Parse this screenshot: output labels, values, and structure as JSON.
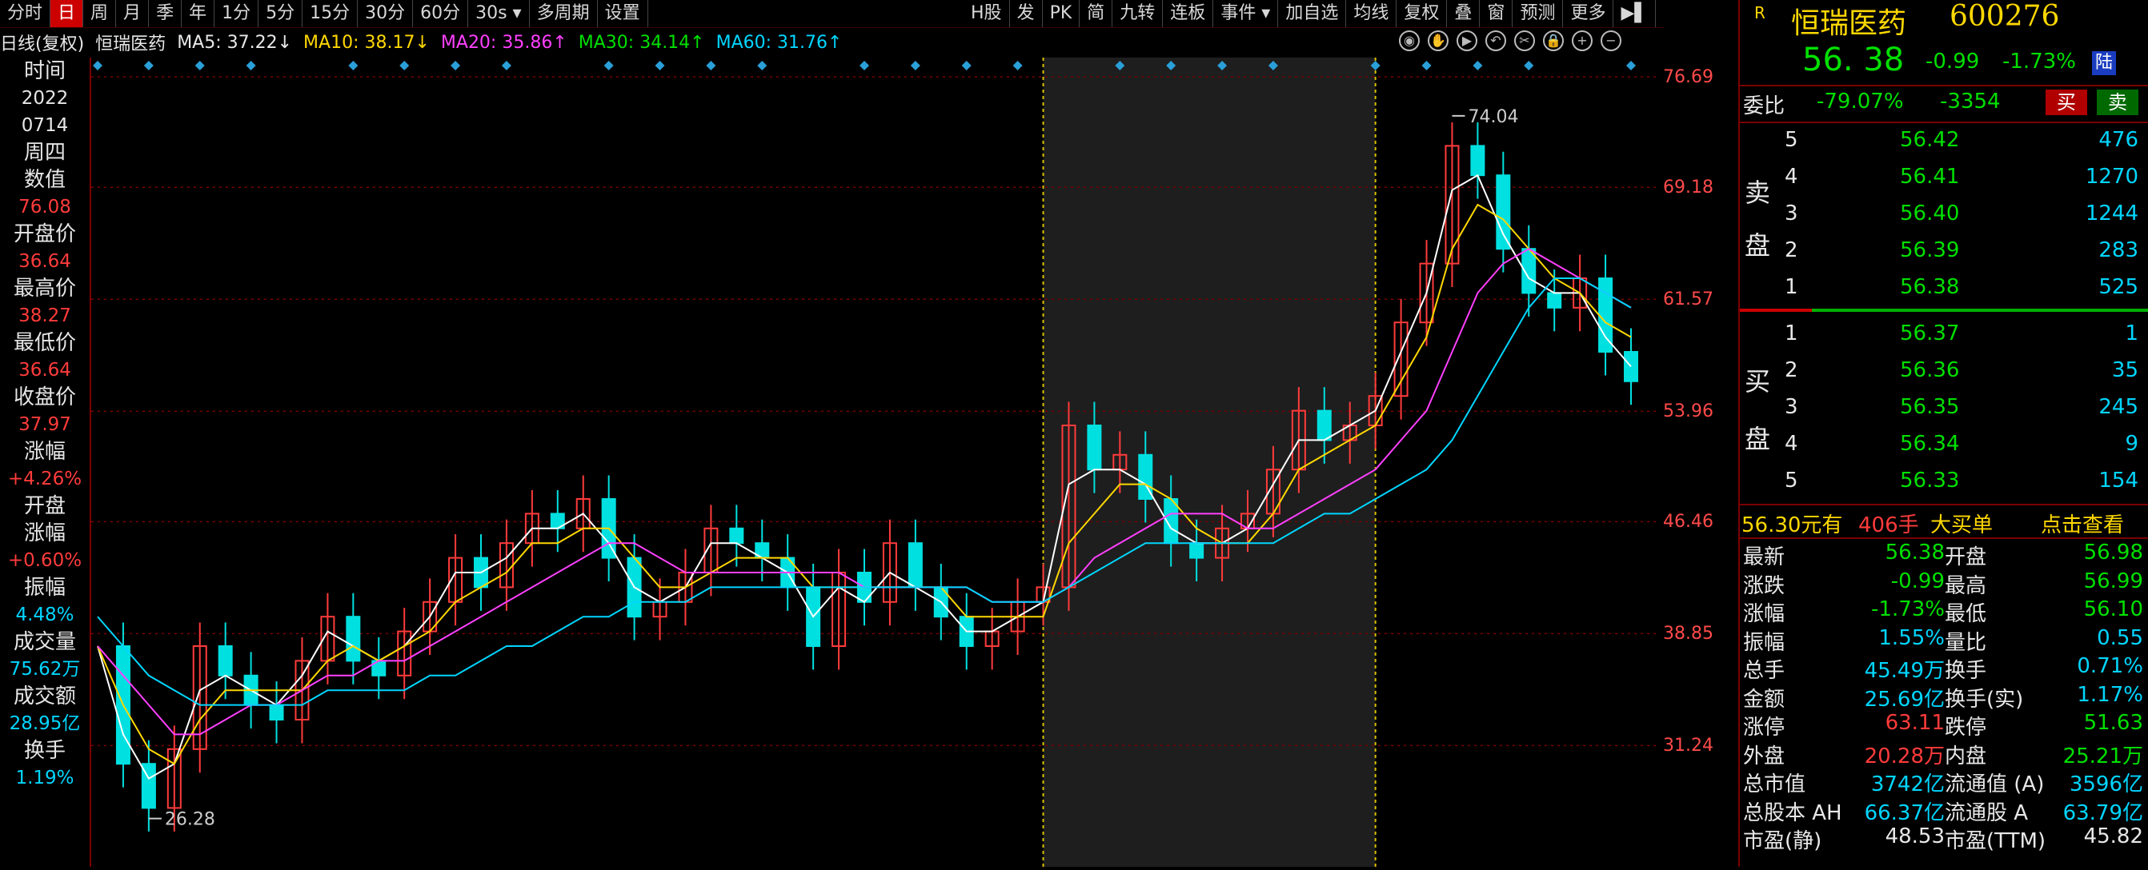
{
  "toolbar": {
    "left": [
      "分时",
      "日",
      "周",
      "月",
      "季",
      "年",
      "1分",
      "5分",
      "15分",
      "30分",
      "60分",
      "30s ▾",
      "多周期",
      "设置"
    ],
    "active_index": 1,
    "right": [
      "H股",
      "发",
      "PK",
      "简",
      "九转",
      "连板",
      "事件 ▾",
      "加自选",
      "均线",
      "复权",
      "叠",
      "窗",
      "预测",
      "更多",
      "▶▌"
    ]
  },
  "ma_row": {
    "prefix": "日线(复权)",
    "stock": "恒瑞医药",
    "ma5": "MA5: 37.22↓",
    "ma10": "MA10: 38.17↓",
    "ma20": "MA20: 35.86↑",
    "ma30": "MA30: 34.14↑",
    "ma60": "MA60: 31.76↑"
  },
  "chart_tools": [
    "eye",
    "hand",
    "play",
    "undo",
    "cut",
    "lock",
    "plus",
    "minus"
  ],
  "left_panel": [
    {
      "label": "时间",
      "value": "2022",
      "color": "#e6e6e6"
    },
    {
      "label": "",
      "value": "0714",
      "color": "#e6e6e6"
    },
    {
      "label": "周四",
      "value": "",
      "color": "#e6e6e6"
    },
    {
      "label": "数值",
      "value": "76.08",
      "color": "#ff3b3b"
    },
    {
      "label": "开盘价",
      "value": "36.64",
      "color": "#ff3b3b"
    },
    {
      "label": "最高价",
      "value": "38.27",
      "color": "#ff3b3b"
    },
    {
      "label": "最低价",
      "value": "36.64",
      "color": "#ff3b3b"
    },
    {
      "label": "收盘价",
      "value": "37.97",
      "color": "#ff3b3b"
    },
    {
      "label": "涨幅",
      "value": "+4.26%",
      "color": "#ff3b3b"
    },
    {
      "label": "开盘",
      "value": "",
      "color": "#e6e6e6"
    },
    {
      "label": "涨幅",
      "value": "+0.60%",
      "color": "#ff3b3b"
    },
    {
      "label": "振幅",
      "value": "4.48%",
      "color": "#00d6ff"
    },
    {
      "label": "成交量",
      "value": "75.62万",
      "color": "#00d6ff"
    },
    {
      "label": "成交额",
      "value": "28.95亿",
      "color": "#00d6ff"
    },
    {
      "label": "换手",
      "value": "1.19%",
      "color": "#00d6ff"
    }
  ],
  "chart_data": {
    "type": "line",
    "y_axis": [
      76.69,
      69.18,
      61.57,
      53.96,
      46.46,
      38.85,
      31.24
    ],
    "ylim": [
      23.0,
      78.0
    ],
    "max_label": "74.04",
    "min_label": "26.28",
    "x": [
      0,
      4,
      8,
      12,
      16,
      20,
      24,
      28,
      32,
      36,
      40,
      44,
      48,
      52,
      56,
      60,
      64,
      68,
      72,
      76,
      80,
      84,
      88,
      92,
      96,
      100,
      104,
      108,
      112,
      116,
      120,
      124,
      128,
      132,
      136,
      140,
      144,
      148,
      152,
      156,
      160,
      164,
      168,
      172,
      176,
      180,
      184,
      188,
      192,
      196,
      200,
      204,
      208,
      212,
      216,
      220,
      224,
      228,
      232,
      236,
      240
    ],
    "close": [
      38,
      30,
      27,
      31,
      38,
      36,
      34,
      33,
      37,
      40,
      37,
      36,
      39,
      41,
      44,
      42,
      45,
      47,
      46,
      48,
      44,
      40,
      41,
      43,
      46,
      45,
      44,
      42,
      38,
      43,
      41,
      45,
      42,
      40,
      38,
      39,
      41,
      42,
      53,
      50,
      51,
      48,
      45,
      44,
      46,
      47,
      50,
      54,
      52,
      53,
      55,
      60,
      64,
      72,
      70,
      65,
      62,
      61,
      63,
      58,
      56
    ],
    "series": [
      {
        "name": "MA5",
        "color": "#ffffff",
        "values": [
          38,
          32,
          29,
          30,
          35,
          36,
          35,
          34,
          36,
          39,
          38,
          37,
          38,
          40,
          43,
          43,
          44,
          46,
          46,
          47,
          45,
          42,
          41,
          42,
          45,
          45,
          44,
          43,
          40,
          42,
          41,
          43,
          42,
          41,
          39,
          39,
          40,
          41,
          49,
          50,
          50,
          49,
          46,
          45,
          45,
          46,
          49,
          52,
          52,
          53,
          54,
          58,
          62,
          69,
          70,
          66,
          63,
          62,
          62,
          59,
          57
        ]
      },
      {
        "name": "MA10",
        "color": "#ffd800",
        "values": [
          38,
          34,
          31,
          30,
          33,
          35,
          35,
          35,
          35,
          37,
          38,
          37,
          38,
          39,
          41,
          42,
          43,
          45,
          45,
          46,
          46,
          44,
          42,
          42,
          43,
          44,
          44,
          44,
          42,
          42,
          42,
          42,
          42,
          42,
          40,
          40,
          40,
          40,
          45,
          47,
          49,
          49,
          48,
          46,
          45,
          45,
          47,
          50,
          51,
          52,
          53,
          56,
          59,
          65,
          68,
          67,
          65,
          63,
          62,
          60,
          59
        ]
      },
      {
        "name": "MA20",
        "color": "#ff40ff",
        "values": [
          38,
          36,
          34,
          32,
          32,
          33,
          34,
          34,
          35,
          36,
          36,
          37,
          37,
          38,
          39,
          40,
          41,
          42,
          43,
          44,
          45,
          45,
          44,
          43,
          43,
          43,
          43,
          43,
          43,
          43,
          42,
          42,
          42,
          42,
          42,
          41,
          41,
          41,
          42,
          44,
          45,
          46,
          47,
          47,
          47,
          46,
          46,
          47,
          48,
          49,
          50,
          52,
          54,
          58,
          62,
          64,
          65,
          64,
          63,
          62,
          61
        ]
      },
      {
        "name": "MA60",
        "color": "#00d6ff",
        "values": [
          40,
          38,
          36,
          35,
          34,
          34,
          34,
          34,
          34,
          35,
          35,
          35,
          35,
          36,
          36,
          37,
          38,
          38,
          39,
          40,
          40,
          41,
          41,
          41,
          42,
          42,
          42,
          42,
          42,
          42,
          42,
          42,
          42,
          42,
          42,
          41,
          41,
          41,
          42,
          43,
          44,
          45,
          45,
          45,
          45,
          45,
          45,
          46,
          47,
          47,
          48,
          49,
          50,
          52,
          55,
          58,
          61,
          63,
          63,
          62,
          61
        ]
      }
    ],
    "highlight_range": [
      148,
      200
    ],
    "grid": true
  },
  "right_panel": {
    "badge": "R",
    "name": "恒瑞医药",
    "code": "600276",
    "price": "56. 38",
    "change": "-0.99",
    "change_pct": "-1.73%",
    "market_tag": "陆",
    "weibi_label": "委比",
    "weibi_pct": "-79.07%",
    "weicha": "-3354",
    "buy_btn": "买",
    "sell_btn": "卖",
    "sell_side_label": [
      "卖",
      "盘"
    ],
    "buy_side_label": [
      "买",
      "盘"
    ],
    "asks": [
      {
        "lvl": "5",
        "price": "56.42",
        "vol": "476"
      },
      {
        "lvl": "4",
        "price": "56.41",
        "vol": "1270"
      },
      {
        "lvl": "3",
        "price": "56.40",
        "vol": "1244"
      },
      {
        "lvl": "2",
        "price": "56.39",
        "vol": "283"
      },
      {
        "lvl": "1",
        "price": "56.38",
        "vol": "525"
      }
    ],
    "bids": [
      {
        "lvl": "1",
        "price": "56.37",
        "vol": "1"
      },
      {
        "lvl": "2",
        "price": "56.36",
        "vol": "35"
      },
      {
        "lvl": "3",
        "price": "56.35",
        "vol": "245"
      },
      {
        "lvl": "4",
        "price": "56.34",
        "vol": "9"
      },
      {
        "lvl": "5",
        "price": "56.33",
        "vol": "154"
      }
    ],
    "bigorder": {
      "price": "56.30元有",
      "lots": "406手",
      "text": "大买单",
      "link": "点击查看"
    },
    "stats": [
      {
        "l1": "最新",
        "v1": "56.38",
        "c1": "#00e000",
        "l2": "开盘",
        "v2": "56.98",
        "c2": "#00e000"
      },
      {
        "l1": "涨跌",
        "v1": "-0.99",
        "c1": "#00e000",
        "l2": "最高",
        "v2": "56.99",
        "c2": "#00e000"
      },
      {
        "l1": "涨幅",
        "v1": "-1.73%",
        "c1": "#00e000",
        "l2": "最低",
        "v2": "56.10",
        "c2": "#00e000"
      },
      {
        "l1": "振幅",
        "v1": "1.55%",
        "c1": "#00d6ff",
        "l2": "量比",
        "v2": "0.55",
        "c2": "#00d6ff"
      },
      {
        "l1": "总手",
        "v1": "45.49万",
        "c1": "#00d6ff",
        "l2": "换手",
        "v2": "0.71%",
        "c2": "#00d6ff"
      },
      {
        "l1": "金额",
        "v1": "25.69亿",
        "c1": "#00d6ff",
        "l2": "换手(实)",
        "v2": "1.17%",
        "c2": "#00d6ff"
      },
      {
        "l1": "涨停",
        "v1": "63.11",
        "c1": "#ff3b3b",
        "l2": "跌停",
        "v2": "51.63",
        "c2": "#00e000"
      },
      {
        "l1": "外盘",
        "v1": "20.28万",
        "c1": "#ff3b3b",
        "l2": "内盘",
        "v2": "25.21万",
        "c2": "#00e000"
      },
      {
        "l1": "总市值",
        "v1": "3742亿",
        "c1": "#00d6ff",
        "l2": "流通值 (A)",
        "v2": "3596亿",
        "c2": "#00d6ff"
      },
      {
        "l1": "总股本 AH",
        "v1": "66.37亿",
        "c1": "#00d6ff",
        "l2": "流通股 A",
        "v2": "63.79亿",
        "c2": "#00d6ff"
      },
      {
        "l1": "市盈(静)",
        "v1": "48.53",
        "c1": "#e8e8e8",
        "l2": "市盈(TTM)",
        "v2": "45.82",
        "c2": "#e8e8e8"
      }
    ]
  }
}
